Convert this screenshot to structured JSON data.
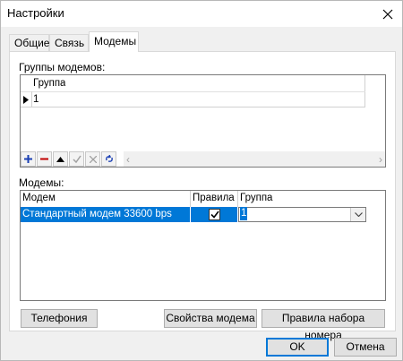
{
  "window": {
    "title": "Настройки"
  },
  "tabs": [
    {
      "label": "Общие"
    },
    {
      "label": "Связь"
    },
    {
      "label": "Модемы"
    }
  ],
  "modem_groups": {
    "label": "Группы модемов:",
    "column": "Группа",
    "rows": [
      "1"
    ]
  },
  "modems": {
    "label": "Модемы:",
    "columns": [
      "Модем",
      "Правила н",
      "Группа"
    ],
    "rows": [
      {
        "modem": "Стандартный модем 33600 bps",
        "rules_checked": true,
        "group": "1"
      }
    ]
  },
  "buttons": {
    "telephony": "Телефония",
    "modem_props": "Свойства модема",
    "dial_rules": "Правила набора номера",
    "ok": "OK",
    "cancel": "Отмена"
  },
  "colors": {
    "selection": "#0078d7",
    "accent_plus": "#1a3fb3",
    "accent_minus": "#c00000"
  }
}
